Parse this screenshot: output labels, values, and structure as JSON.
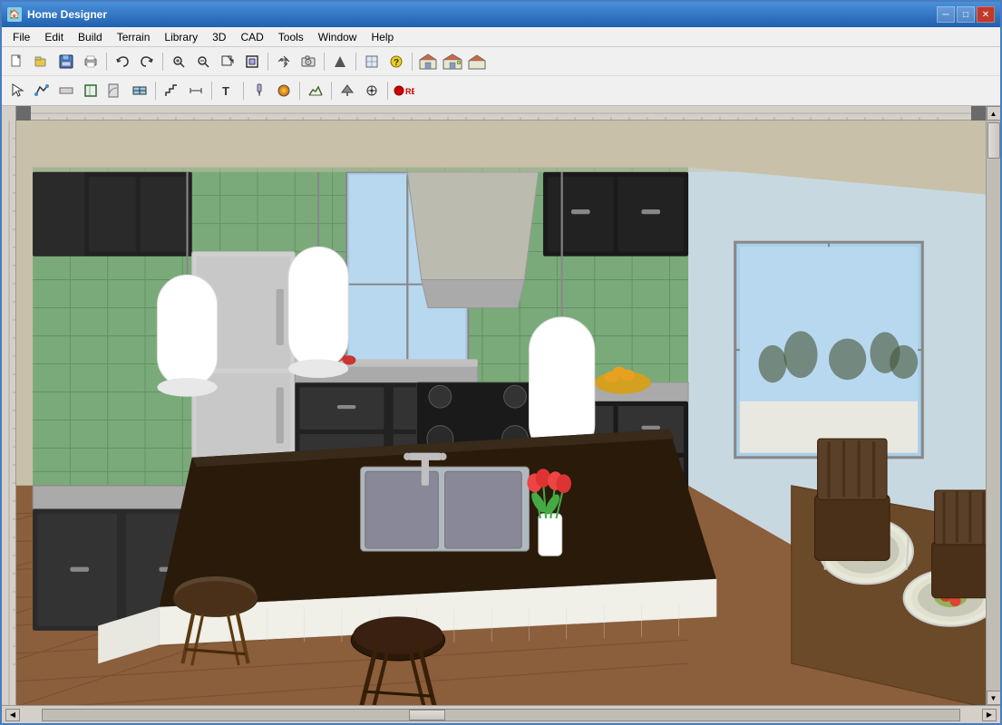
{
  "window": {
    "title": "Home Designer",
    "icon": "🏠"
  },
  "title_controls": {
    "minimize": "─",
    "maximize": "□",
    "close": "✕"
  },
  "menu": {
    "items": [
      {
        "label": "File",
        "id": "file"
      },
      {
        "label": "Edit",
        "id": "edit"
      },
      {
        "label": "Build",
        "id": "build"
      },
      {
        "label": "Terrain",
        "id": "terrain"
      },
      {
        "label": "Library",
        "id": "library"
      },
      {
        "label": "3D",
        "id": "3d"
      },
      {
        "label": "CAD",
        "id": "cad"
      },
      {
        "label": "Tools",
        "id": "tools"
      },
      {
        "label": "Window",
        "id": "window"
      },
      {
        "label": "Help",
        "id": "help"
      }
    ]
  },
  "toolbar1": {
    "buttons": [
      {
        "id": "new",
        "icon": "📄",
        "tooltip": "New"
      },
      {
        "id": "open",
        "icon": "📂",
        "tooltip": "Open"
      },
      {
        "id": "save",
        "icon": "💾",
        "tooltip": "Save"
      },
      {
        "id": "print",
        "icon": "🖨",
        "tooltip": "Print"
      },
      {
        "id": "undo",
        "icon": "↩",
        "tooltip": "Undo"
      },
      {
        "id": "redo",
        "icon": "↪",
        "tooltip": "Redo"
      },
      {
        "id": "zoom-out2",
        "icon": "🔍",
        "tooltip": "Zoom Out"
      },
      {
        "id": "zoom-in2",
        "icon": "🔎",
        "tooltip": "Zoom In"
      },
      {
        "id": "zoom-out",
        "icon": "⊖",
        "tooltip": "Zoom Out"
      },
      {
        "id": "zoom-fit",
        "icon": "⊡",
        "tooltip": "Fit"
      },
      {
        "id": "view1",
        "icon": "⊞",
        "tooltip": "View"
      },
      {
        "id": "arrows",
        "icon": "✦",
        "tooltip": "Arrows"
      },
      {
        "id": "camera",
        "icon": "📷",
        "tooltip": "Camera"
      },
      {
        "id": "help-btn",
        "icon": "?",
        "tooltip": "Help"
      },
      {
        "id": "house1",
        "icon": "🏠",
        "tooltip": "House"
      },
      {
        "id": "house2",
        "icon": "🏡",
        "tooltip": "House 2"
      },
      {
        "id": "house3",
        "icon": "⌂",
        "tooltip": "House 3"
      }
    ]
  },
  "toolbar2": {
    "buttons": [
      {
        "id": "select",
        "icon": "↖",
        "tooltip": "Select"
      },
      {
        "id": "polyline",
        "icon": "∟",
        "tooltip": "Polyline"
      },
      {
        "id": "wall",
        "icon": "⊟",
        "tooltip": "Wall"
      },
      {
        "id": "room",
        "icon": "▦",
        "tooltip": "Room"
      },
      {
        "id": "door",
        "icon": "⊡",
        "tooltip": "Door"
      },
      {
        "id": "window-tool",
        "icon": "⊞",
        "tooltip": "Window"
      },
      {
        "id": "stairs",
        "icon": "≡",
        "tooltip": "Stairs"
      },
      {
        "id": "dimension",
        "icon": "⟺",
        "tooltip": "Dimension"
      },
      {
        "id": "text-tool",
        "icon": "T",
        "tooltip": "Text"
      },
      {
        "id": "paint",
        "icon": "🖌",
        "tooltip": "Paint"
      },
      {
        "id": "material",
        "icon": "◈",
        "tooltip": "Material"
      },
      {
        "id": "terrain-btn",
        "icon": "⛰",
        "tooltip": "Terrain"
      },
      {
        "id": "up-arrow",
        "icon": "⬆",
        "tooltip": "Up"
      },
      {
        "id": "transform",
        "icon": "⊕",
        "tooltip": "Transform"
      },
      {
        "id": "record",
        "icon": "⏺",
        "tooltip": "Record"
      }
    ]
  },
  "status": {
    "left_corner": "◀",
    "right_corner": "▶",
    "up_arrow": "▲",
    "down_arrow": "▼"
  }
}
